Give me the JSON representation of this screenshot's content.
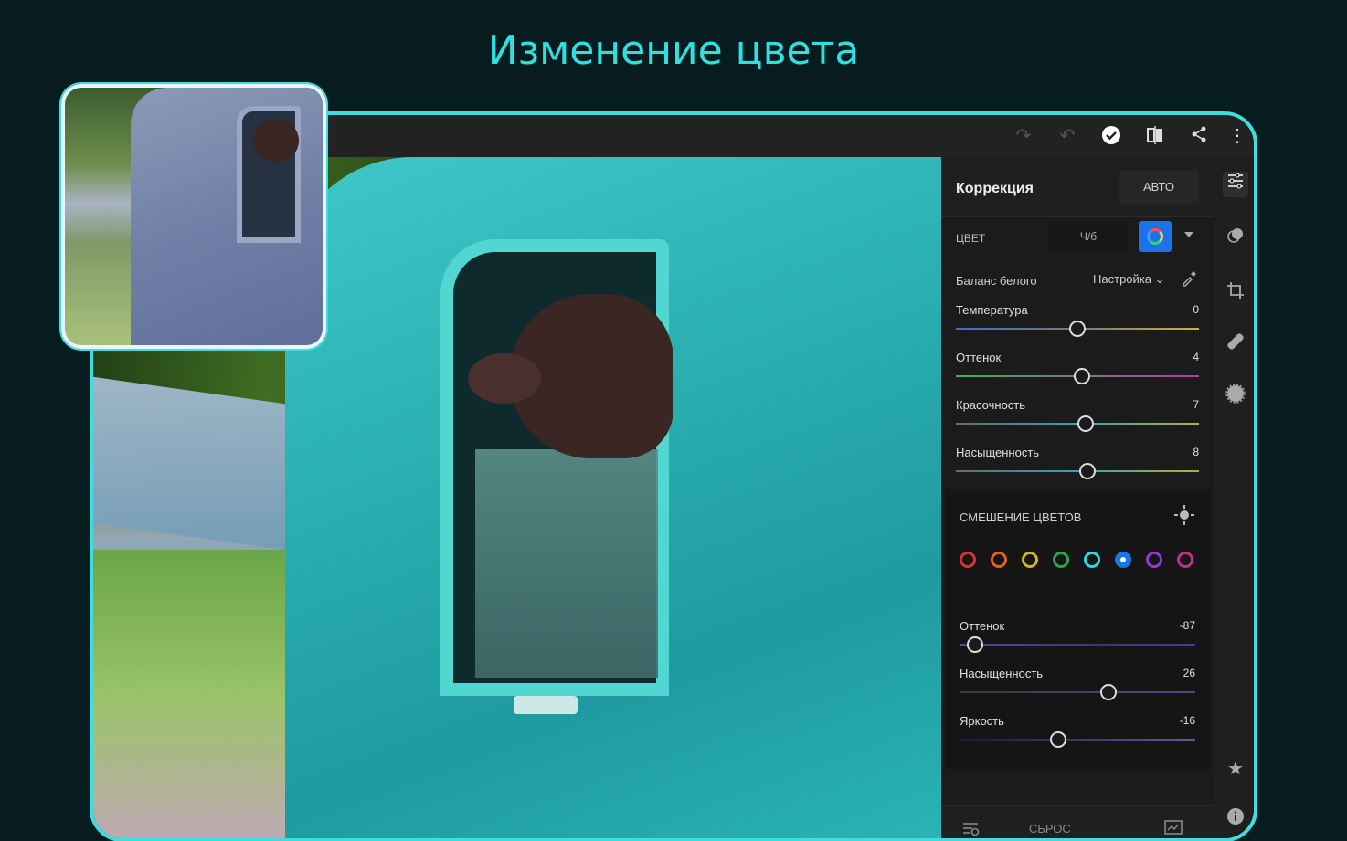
{
  "headline": "Изменение цвета",
  "topbar": {
    "icons": [
      "redo-icon",
      "undo-icon",
      "check-circle-icon",
      "compare-icon",
      "share-icon",
      "more-vert-icon"
    ]
  },
  "panel": {
    "title": "Коррекция",
    "auto_label": "АВТО",
    "color_label": "ЦВЕТ",
    "bw_label": "Ч/б",
    "white_balance": {
      "label": "Баланс белого",
      "value": "Настройка"
    },
    "sliders": [
      {
        "name": "Температура",
        "value": "0",
        "pos": 0.5,
        "track": "linear-gradient(90deg,#3a6fc9,#7a7a7a 50%,#c9b43a)"
      },
      {
        "name": "Оттенок",
        "value": "4",
        "pos": 0.52,
        "track": "linear-gradient(90deg,#3ab05a,#7a7a7a 50%,#b03ab0)"
      },
      {
        "name": "Красочность",
        "value": "7",
        "pos": 0.535,
        "track": "linear-gradient(90deg,#6a6a6a,#3aa0b0 50%,#b0b03a)"
      },
      {
        "name": "Насыщенность",
        "value": "8",
        "pos": 0.54,
        "track": "linear-gradient(90deg,#6a6a6a,#3aa0b0 50%,#b0b03a)"
      }
    ],
    "mix": {
      "title": "СМЕШЕНИЕ ЦВЕТОВ",
      "dots": [
        "#e03030",
        "#e0602a",
        "#d6b020",
        "#2aa84a",
        "#2fd6e6",
        "#1a73e8",
        "#8a3ad6",
        "#c0308a"
      ],
      "selected": 5,
      "sliders": [
        {
          "name": "Оттенок",
          "value": "-87",
          "pos": 0.065,
          "track": "linear-gradient(90deg,#4a4aa0,#3a3a70 60%,#4a3aa0)"
        },
        {
          "name": "Насыщенность",
          "value": "26",
          "pos": 0.63,
          "track": "linear-gradient(90deg,#3a3a3a,#4a4a90)"
        },
        {
          "name": "Яркость",
          "value": "-16",
          "pos": 0.42,
          "track": "linear-gradient(90deg,#1a1a3a,#5a5aa0)"
        }
      ]
    },
    "footer": {
      "reset_label": "СБРОС"
    }
  },
  "rail": {
    "icons": [
      "sliders-icon",
      "masking-icon",
      "crop-icon",
      "healing-icon",
      "optics-icon",
      "star-icon",
      "info-icon"
    ]
  }
}
